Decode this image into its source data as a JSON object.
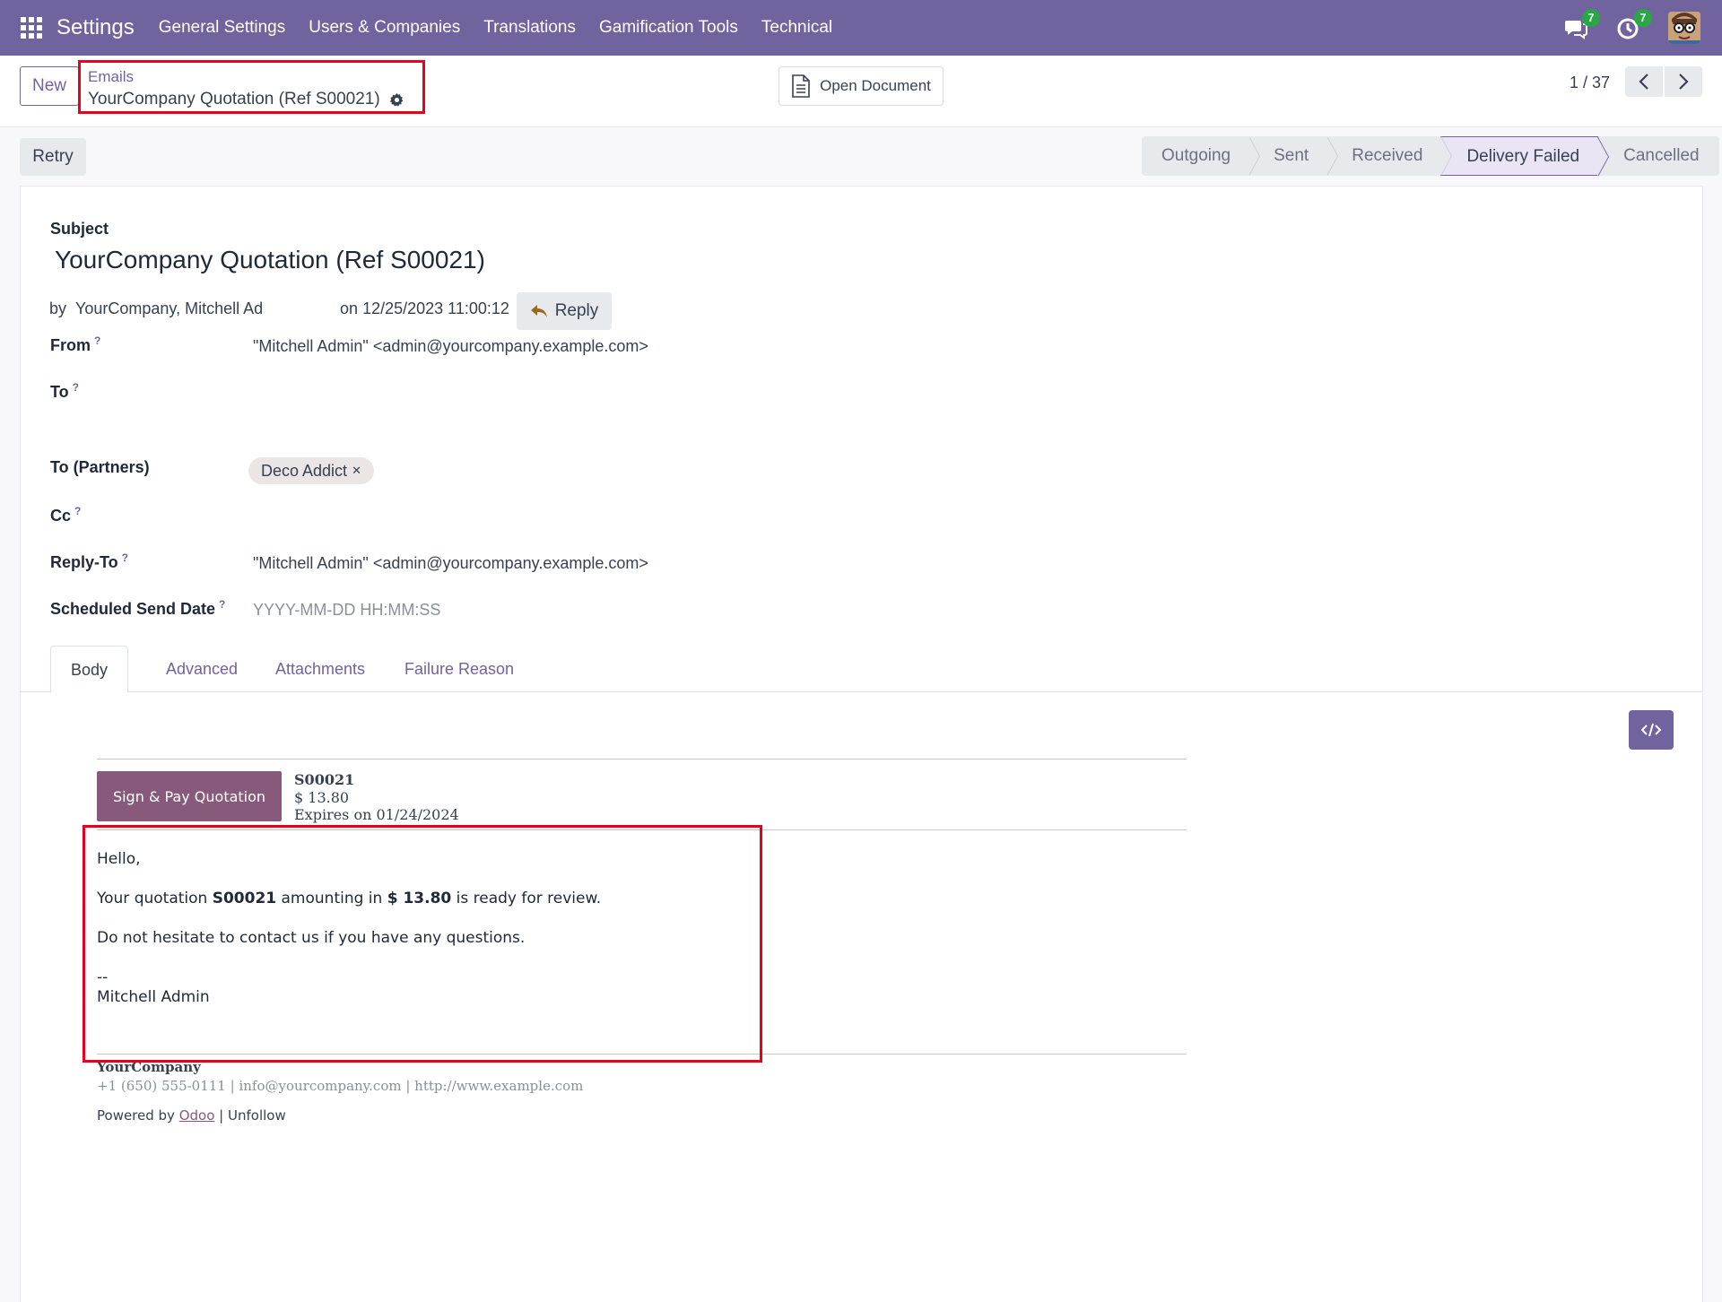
{
  "navbar": {
    "brand": "Settings",
    "menu": [
      "General Settings",
      "Users & Companies",
      "Translations",
      "Gamification Tools",
      "Technical"
    ],
    "messages_count": "7",
    "activities_count": "7"
  },
  "control": {
    "new_label": "New",
    "breadcrumb_parent": "Emails",
    "breadcrumb_current": "YourCompany Quotation (Ref S00021)",
    "open_document_label": "Open Document",
    "pager_value": "1 / 37"
  },
  "actions": {
    "retry_label": "Retry"
  },
  "statusbar": {
    "stages": [
      "Outgoing",
      "Sent",
      "Received",
      "Delivery Failed",
      "Cancelled"
    ],
    "active": "Delivery Failed"
  },
  "form": {
    "subject_label": "Subject",
    "subject_value": "YourCompany Quotation (Ref S00021)",
    "by_prefix": "by",
    "author": "YourCompany, Mitchell Ad",
    "date_prefix": "on",
    "date": "12/25/2023 11:00:12",
    "reply_label": "Reply",
    "from_label": "From",
    "from_value": "\"Mitchell Admin\" <admin@yourcompany.example.com>",
    "to_label": "To",
    "to_partners_label": "To (Partners)",
    "to_partners_tag": "Deco Addict",
    "cc_label": "Cc",
    "reply_to_label": "Reply-To",
    "reply_to_value": "\"Mitchell Admin\" <admin@yourcompany.example.com>",
    "scheduled_label": "Scheduled Send Date",
    "scheduled_placeholder": "YYYY-MM-DD HH:MM:SS",
    "help_mark": "?"
  },
  "tabs": [
    "Body",
    "Advanced",
    "Attachments",
    "Failure Reason"
  ],
  "email": {
    "sign_button": "Sign & Pay Quotation",
    "quote_ref": "S00021",
    "amount": "$ 13.80",
    "expires": "Expires on 01/24/2024",
    "greeting": "Hello,",
    "line1_pre": "Your quotation ",
    "line1_ref": "S00021",
    "line1_mid": " amounting in ",
    "line1_amount": "$ 13.80",
    "line1_post": " is ready for review.",
    "line2": "Do not hesitate to contact us if you have any questions.",
    "sig_dash": "--",
    "signature": "Mitchell Admin",
    "footer_company": "YourCompany",
    "footer_contact": "+1 (650) 555-0111 | info@yourcompany.com | http://www.example.com",
    "powered_prefix": "Powered by ",
    "powered_link": "Odoo",
    "powered_sep": " | ",
    "unfollow": "Unfollow"
  },
  "colors": {
    "brand": "#71639e",
    "email_accent": "#875a7b",
    "badge": "#28a745",
    "highlight_box": "#e8001f"
  }
}
